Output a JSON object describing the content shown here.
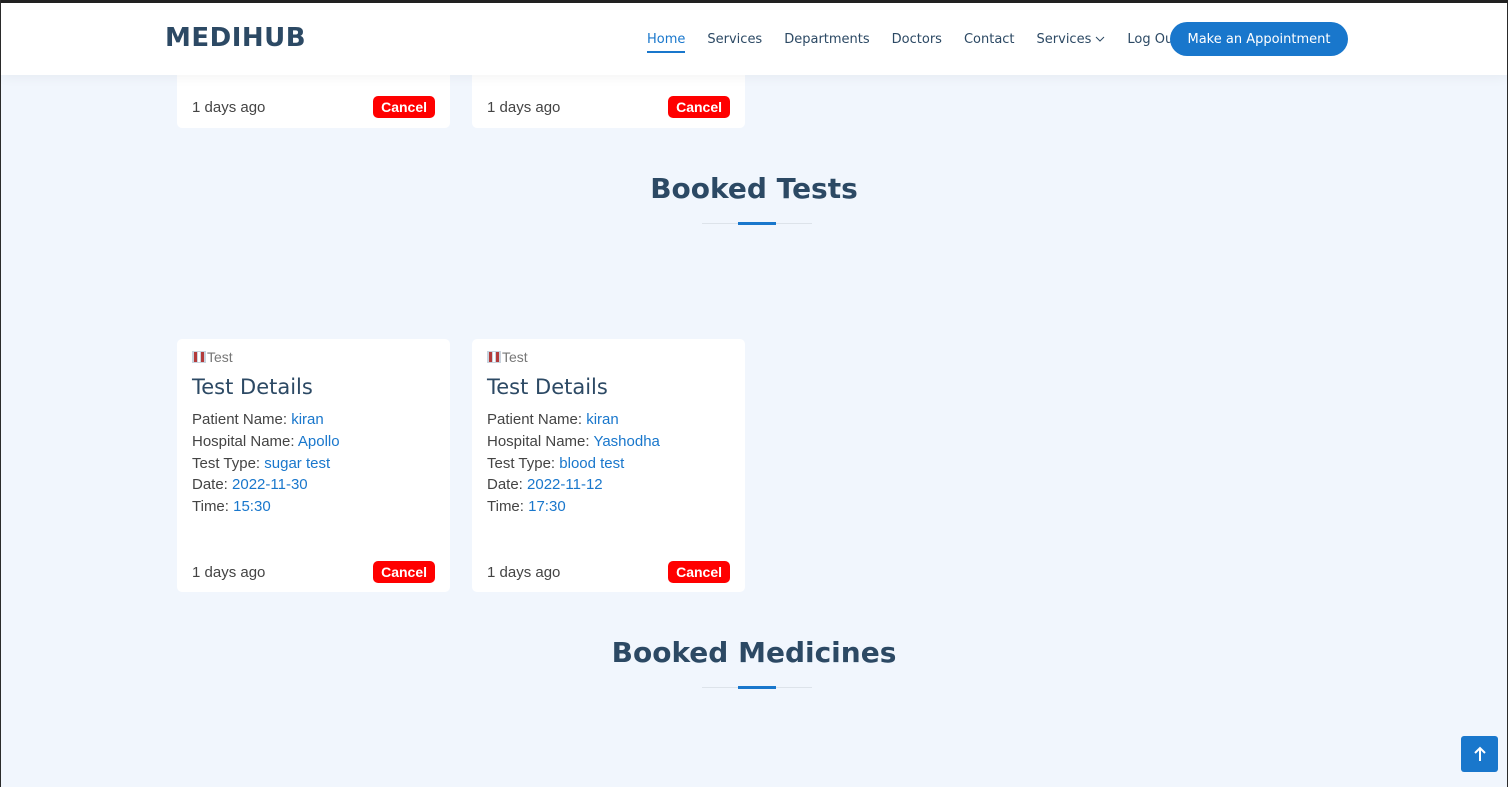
{
  "header": {
    "logo": "MEDIHUB",
    "nav": [
      "Home",
      "Services",
      "Departments",
      "Doctors",
      "Contact",
      "Services",
      "Log Out"
    ],
    "cta": "Make an Appointment"
  },
  "prev_cards": [
    {
      "ago": "1 days ago",
      "cancel": "Cancel"
    },
    {
      "ago": "1 days ago",
      "cancel": "Cancel"
    }
  ],
  "booked_tests": {
    "title": "Booked Tests",
    "cards": [
      {
        "tag": "Test",
        "title": "Test Details",
        "patient_label": "Patient Name:",
        "patient": "kiran",
        "hospital_label": "Hospital Name:",
        "hospital": "Apollo",
        "type_label": "Test Type:",
        "type": "sugar test",
        "date_label": "Date:",
        "date": "2022-11-30",
        "time_label": "Time:",
        "time": "15:30",
        "ago": "1 days ago",
        "cancel": "Cancel"
      },
      {
        "tag": "Test",
        "title": "Test Details",
        "patient_label": "Patient Name:",
        "patient": "kiran",
        "hospital_label": "Hospital Name:",
        "hospital": "Yashodha",
        "type_label": "Test Type:",
        "type": "blood test",
        "date_label": "Date:",
        "date": "2022-11-12",
        "time_label": "Time:",
        "time": "17:30",
        "ago": "1 days ago",
        "cancel": "Cancel"
      }
    ]
  },
  "booked_medicines": {
    "title": "Booked Medicines"
  },
  "colors": {
    "accent": "#1977cc",
    "heading": "#2c4964",
    "danger": "#ff0000",
    "background": "#f1f6fd"
  }
}
